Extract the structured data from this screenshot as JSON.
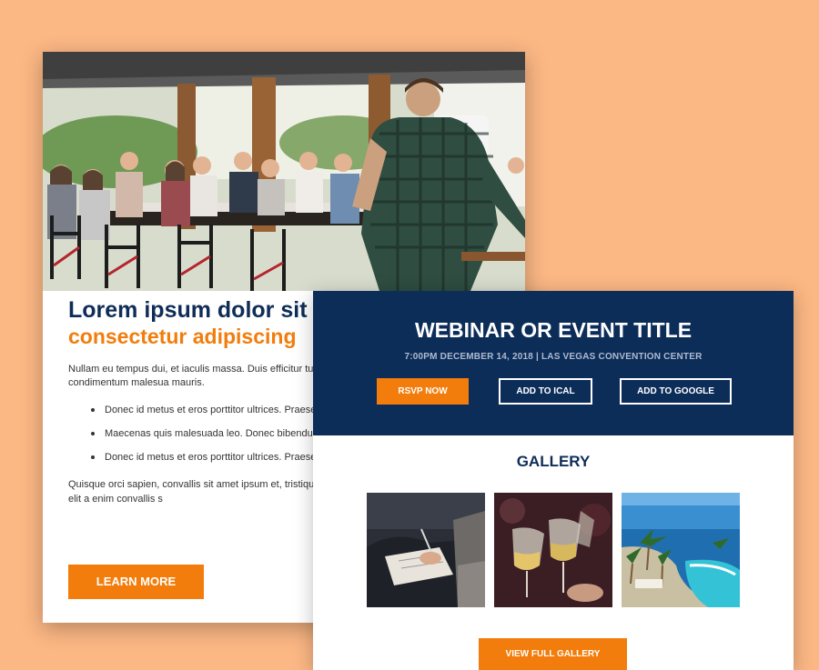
{
  "article": {
    "hero_alt": "speaker presenting to audience at restaurant event",
    "headline_line1": "Lorem ipsum dolor sit",
    "headline_line2": "consectetur adipiscing",
    "intro": "Nullam eu tempus dui, et iaculis massa. Duis efficitur turpi malesuada orci, at tincidunt mauris condimentum malesua mauris.",
    "bullets": [
      "Donec id metus et eros porttitor ultrices. Praesent pellentesque auctor at ac massa.",
      "Maecenas quis malesuada leo. Donec bibendum i",
      "Donec id metus et eros porttitor ultrices. Praesent pellentesque auctor at ac massa"
    ],
    "outro": "Quisque orci sapien, convallis sit amet ipsum et, tristique v sed vestibulum odio. Integer semper elit a enim convallis s",
    "cta_label": "LEARN MORE"
  },
  "event": {
    "title": "WEBINAR OR EVENT TITLE",
    "meta": "7:00PM DECEMBER 14, 2018 | LAS VEGAS CONVENTION CENTER",
    "rsvp_label": "RSVP NOW",
    "ical_label": "ADD TO ICAL",
    "google_label": "ADD TO GOOGLE"
  },
  "gallery": {
    "title": "GALLERY",
    "images": [
      "people taking notes",
      "wine glasses toast",
      "tropical resort pool"
    ],
    "button_label": "VIEW FULL GALLERY"
  },
  "colors": {
    "background": "#fbb784",
    "navy": "#0d2d59",
    "orange": "#f27d0c"
  }
}
